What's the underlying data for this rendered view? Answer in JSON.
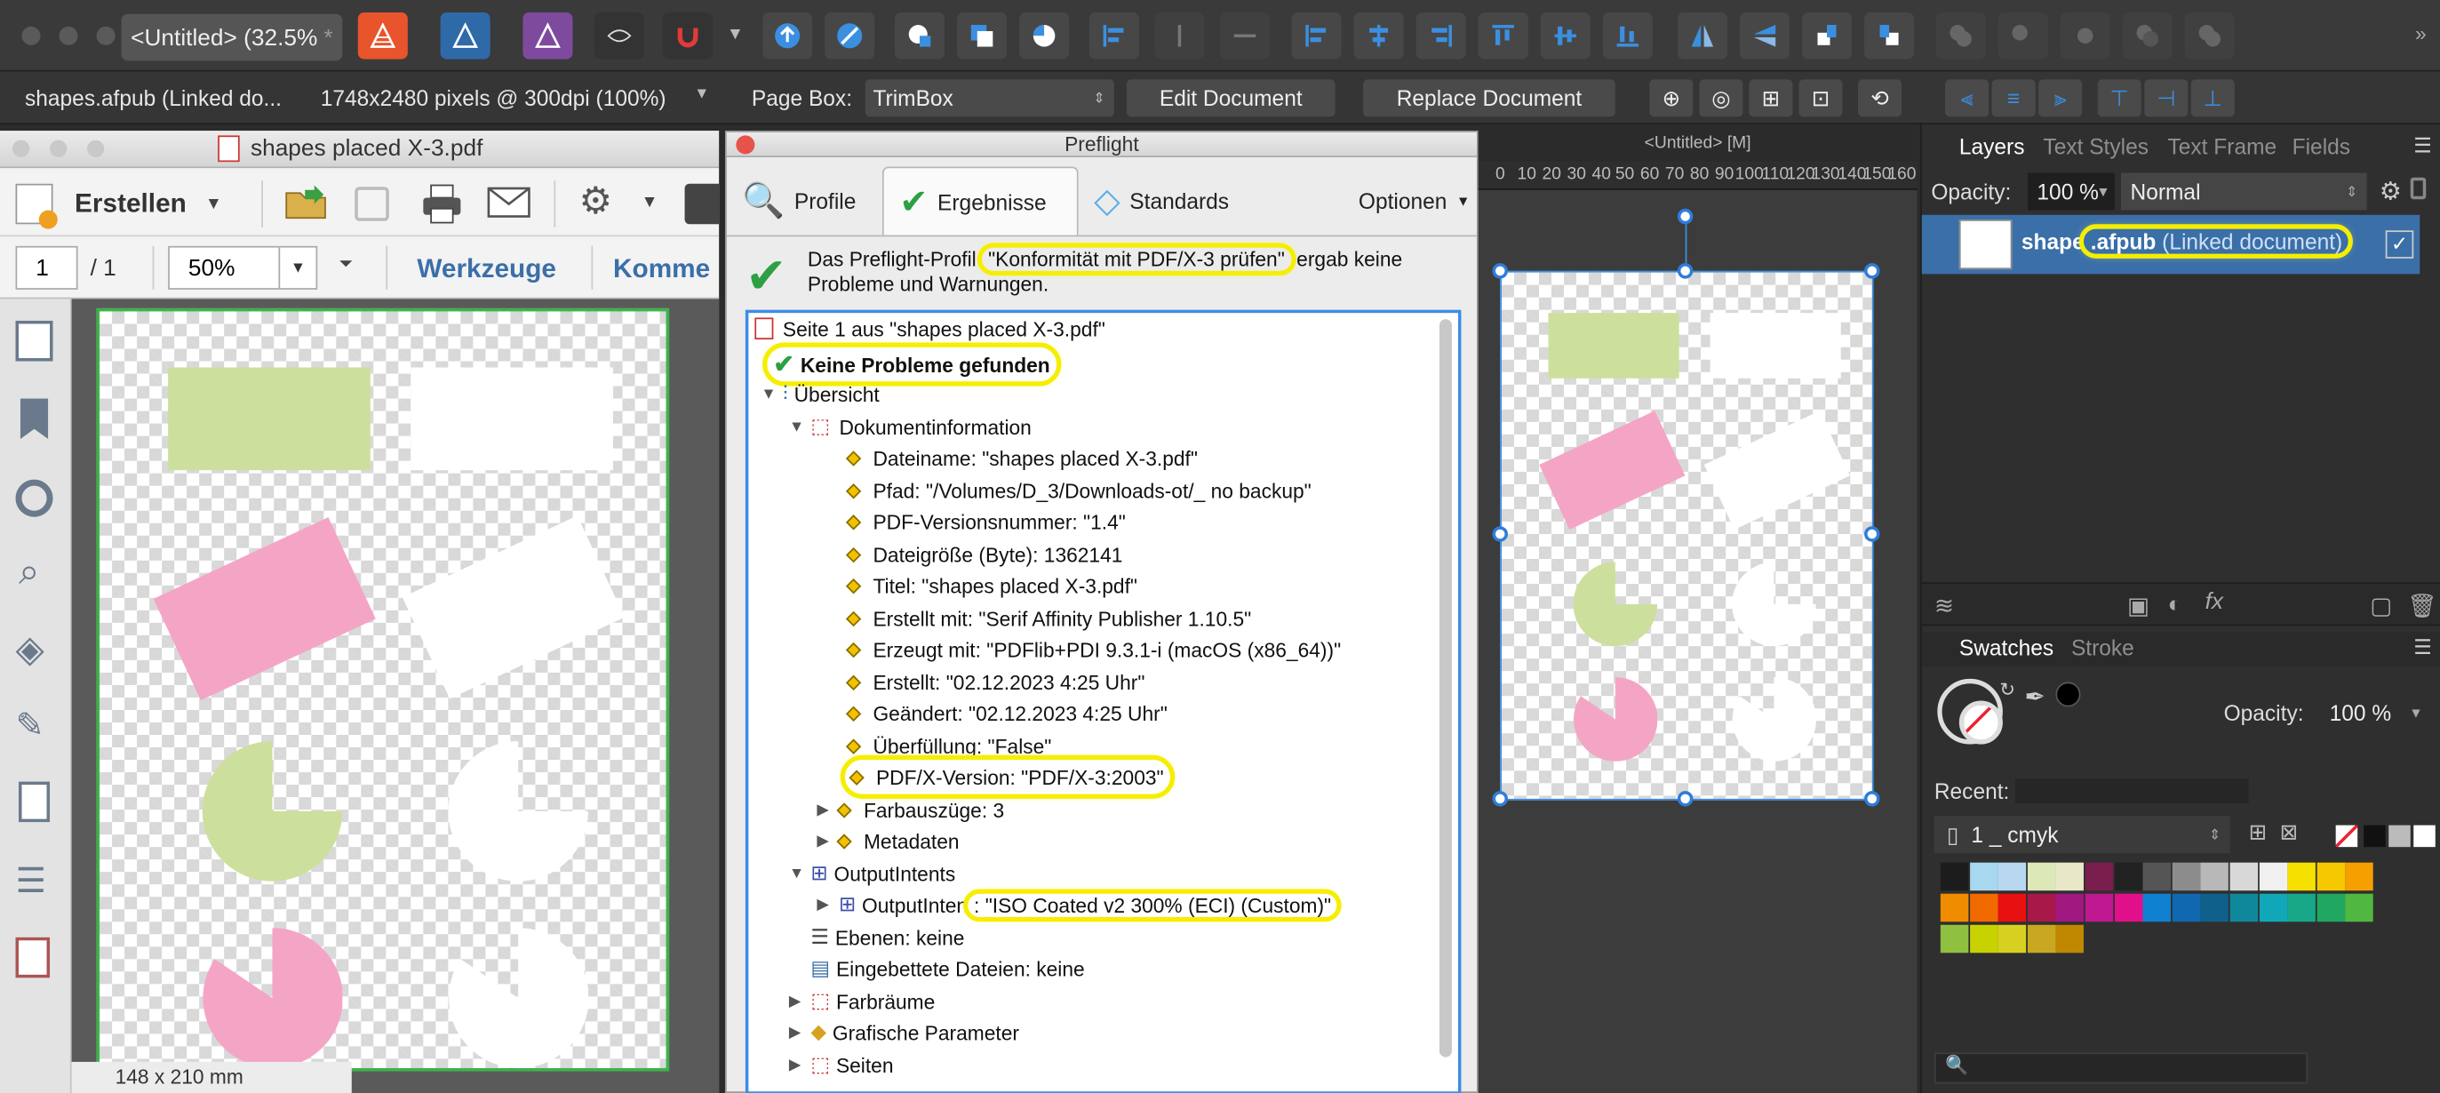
{
  "toolbar": {
    "doc_tab": "<Untitled> (32.5%",
    "doc_tab_close": "*"
  },
  "context": {
    "file": "shapes.afpub (Linked do...",
    "dims": "1748x2480 pixels @ 300dpi (100%)",
    "page_box_label": "Page Box:",
    "page_box_value": "TrimBox",
    "edit_doc": "Edit Document",
    "replace_doc": "Replace Document"
  },
  "acrobat": {
    "title": "shapes placed X-3.pdf",
    "create": "Erstellen",
    "page_current": "1",
    "page_total": "/ 1",
    "zoom": "50%",
    "tools": "Werkzeuge",
    "comment": "Komme",
    "size": "148 x 210 mm"
  },
  "preflight": {
    "title": "Preflight",
    "tabs": [
      "Profile",
      "Ergebnisse",
      "Standards"
    ],
    "options": "Optionen",
    "summary_pre": "Das Preflight-Profil",
    "summary_profile": "\"Konformität mit PDF/X-3 prüfen\"",
    "summary_post": "ergab keine",
    "summary_line2": "Probleme und Warnungen.",
    "tree": {
      "page": "Seite 1 aus \"shapes placed X-3.pdf\"",
      "no_problems": "Keine Probleme gefunden",
      "overview": "Übersicht",
      "doc_info": "Dokumentinformation",
      "items": [
        "Dateiname: \"shapes placed X-3.pdf\"",
        "Pfad: \"/Volumes/D_3/Downloads-ot/_ no backup\"",
        "PDF-Versionsnummer: \"1.4\"",
        "Dateigröße (Byte): 1362141",
        "Titel: \"shapes placed X-3.pdf\"",
        "Erstellt mit: \"Serif Affinity Publisher 1.10.5\"",
        "Erzeugt mit: \"PDFlib+PDI 9.3.1-i (macOS (x86_64))\"",
        "Erstellt: \"02.12.2023 4:25 Uhr\"",
        "Geändert: \"02.12.2023 4:25 Uhr\"",
        "Überfüllung: \"False\"",
        "PDF/X-Version: \"PDF/X-3:2003\""
      ],
      "color_sep": "Farbauszüge: 3",
      "metadata": "Metadaten",
      "output_intents": "OutputIntents",
      "output_intent_pre": "OutputInten",
      "output_intent_val": ": \"ISO Coated v2 300% (ECI) (Custom)\"",
      "layers": "Ebenen: keine",
      "embedded": "Eingebettete Dateien: keine",
      "color_spaces": "Farbräume",
      "graphic_params": "Grafische Parameter",
      "pages": "Seiten"
    }
  },
  "canvas": {
    "tab_title": "<Untitled> [M]",
    "ruler": [
      "0",
      "10",
      "20",
      "30",
      "40",
      "50",
      "60",
      "70",
      "80",
      "90",
      "100",
      "110",
      "120",
      "130",
      "140",
      "150",
      "160"
    ]
  },
  "layers": {
    "tabs": [
      "Layers",
      "Text Styles",
      "Text Frame",
      "Fields"
    ],
    "opacity_label": "Opacity:",
    "opacity": "100 %",
    "blend": "Normal",
    "layer_name_pre": "shape",
    "layer_name_hl": ".afpub",
    "layer_name_suffix": "(Linked document)"
  },
  "swatches": {
    "tabs": [
      "Swatches",
      "Stroke"
    ],
    "opacity_label": "Opacity:",
    "opacity": "100 %",
    "recent_label": "Recent:",
    "palette": "1 _ cmyk",
    "colors": [
      "#1c1c1c",
      "#a8d8f0",
      "#b8d8f0",
      "#dce8b8",
      "#e8e8c8",
      "#7a1e4e",
      "#222222",
      "#555555",
      "#8c8c8c",
      "#b8b8b8",
      "#d8d8d8",
      "#f0f0f0",
      "#f5e000",
      "#f5c800",
      "#f5a000",
      "#f08c00",
      "#f06a00",
      "#e81010",
      "#a81848",
      "#a01880",
      "#c01890",
      "#e0108a",
      "#1080d0",
      "#1068b0",
      "#10608c",
      "#10889c",
      "#10a8b8",
      "#18a888",
      "#20a860",
      "#50b840",
      "#90c040",
      "#c8d200",
      "#d8d020",
      "#c8a820",
      "#c08800"
    ]
  }
}
